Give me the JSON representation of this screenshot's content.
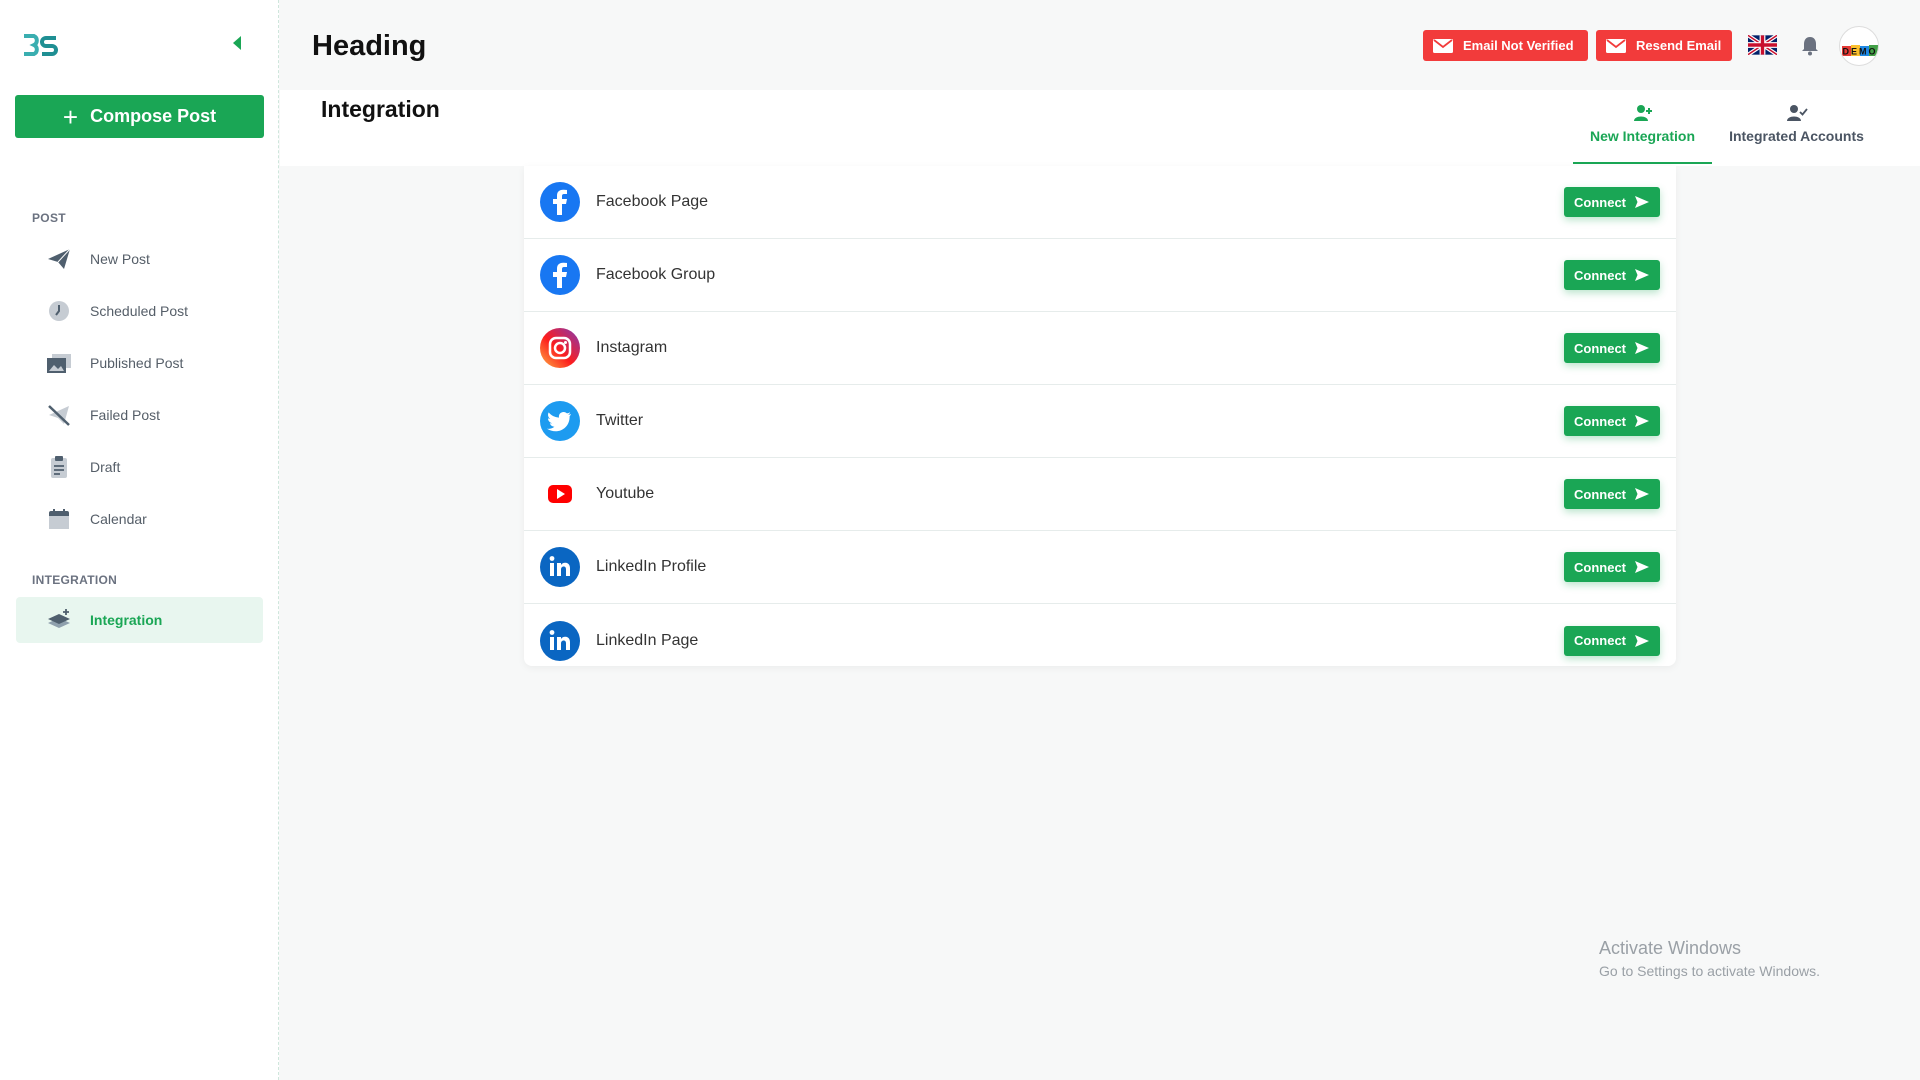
{
  "sidebar": {
    "compose_label": "Compose Post",
    "sections": {
      "post": "POST",
      "integration": "INTEGRATION"
    },
    "items": [
      {
        "label": "New Post",
        "icon": "paper-plane-icon"
      },
      {
        "label": "Scheduled Post",
        "icon": "clock-icon"
      },
      {
        "label": "Published Post",
        "icon": "gallery-icon"
      },
      {
        "label": "Failed Post",
        "icon": "failed-icon"
      },
      {
        "label": "Draft",
        "icon": "clipboard-icon"
      },
      {
        "label": "Calendar",
        "icon": "calendar-icon"
      },
      {
        "label": "Integration",
        "icon": "layers-icon",
        "active": true
      }
    ]
  },
  "header": {
    "heading": "Heading",
    "email_not_verified": "Email Not Verified",
    "resend_email": "Resend Email",
    "avatar_text": "DEMO"
  },
  "content": {
    "title": "Integration",
    "tabs": [
      {
        "label": "New Integration",
        "active": true
      },
      {
        "label": "Integrated Accounts",
        "active": false
      }
    ],
    "connect_label": "Connect",
    "integrations": [
      {
        "name": "Facebook Page",
        "icon": "facebook-icon"
      },
      {
        "name": "Facebook Group",
        "icon": "facebook-icon"
      },
      {
        "name": "Instagram",
        "icon": "instagram-icon"
      },
      {
        "name": "Twitter",
        "icon": "twitter-icon"
      },
      {
        "name": "Youtube",
        "icon": "youtube-icon"
      },
      {
        "name": "LinkedIn Profile",
        "icon": "linkedin-icon"
      },
      {
        "name": "LinkedIn Page",
        "icon": "linkedin-icon"
      }
    ]
  },
  "watermark": {
    "line1": "Activate Windows",
    "line2": "Go to Settings to activate Windows."
  },
  "colors": {
    "accent": "#1aa655",
    "danger": "#f23b3b",
    "facebook": "#1877f2",
    "twitter": "#1d9bf0",
    "linkedin": "#0a66c2",
    "youtube": "#ff0000"
  }
}
